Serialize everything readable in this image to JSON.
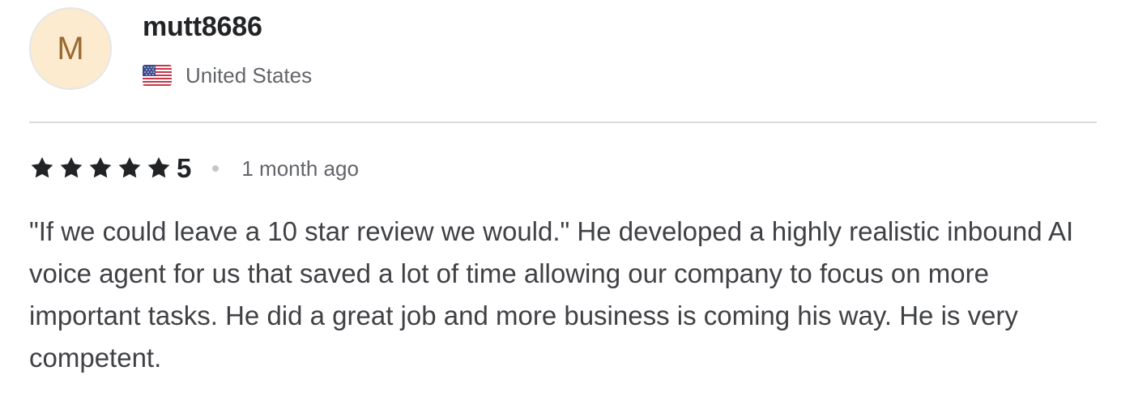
{
  "reviewer": {
    "avatar_initial": "M",
    "avatar_bg": "#fdebd0",
    "avatar_fg": "#9a6a2f",
    "username": "mutt8686",
    "flag_icon": "us-flag-icon",
    "country": "United States"
  },
  "rating": {
    "stars_filled": 5,
    "stars_total": 5,
    "star_icon": "star-icon",
    "star_color": "#222325",
    "value": "5",
    "time_ago": "1 month ago"
  },
  "review": {
    "text": "\"If we could leave a 10 star review we would.\" He developed a highly realistic inbound AI voice agent for us that saved a lot of time allowing our company to focus on more important tasks. He did a great job and more business is coming his way. He is very competent."
  }
}
